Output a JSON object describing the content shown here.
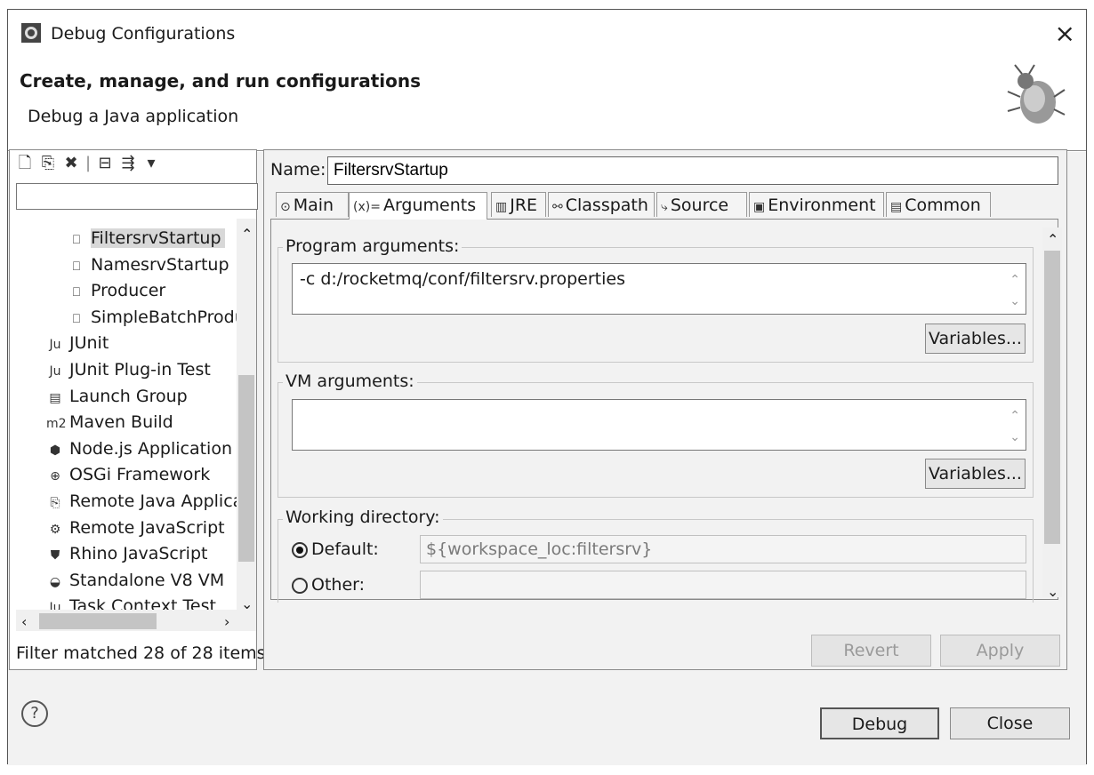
{
  "window": {
    "title": "Debug Configurations",
    "close_symbol": "×"
  },
  "header": {
    "title": "Create, manage, and run configurations",
    "subtitle": "Debug a Java application"
  },
  "left": {
    "toolbar_icons": [
      "new-launch-config-icon",
      "duplicate-icon",
      "delete-icon",
      "collapse-all-icon",
      "filter-icon",
      "view-menu-icon"
    ],
    "filter_value": "",
    "tree": [
      {
        "label": "FiltersrvStartup",
        "icon": "java-app-icon",
        "glyph": "⎕",
        "selected": true,
        "indent": 1
      },
      {
        "label": "NamesrvStartup",
        "icon": "java-app-icon",
        "glyph": "⎕",
        "selected": false,
        "indent": 1
      },
      {
        "label": "Producer",
        "icon": "java-app-icon",
        "glyph": "⎕",
        "selected": false,
        "indent": 1
      },
      {
        "label": "SimpleBatchProdu",
        "icon": "java-app-icon",
        "glyph": "⎕",
        "selected": false,
        "indent": 1
      },
      {
        "label": "JUnit",
        "icon": "junit-icon",
        "glyph": "Ju",
        "selected": false,
        "indent": 0
      },
      {
        "label": "JUnit Plug-in Test",
        "icon": "junit-plugin-icon",
        "glyph": "Ju",
        "selected": false,
        "indent": 0
      },
      {
        "label": "Launch Group",
        "icon": "launch-group-icon",
        "glyph": "▤",
        "selected": false,
        "indent": 0
      },
      {
        "label": "Maven Build",
        "icon": "maven-icon",
        "glyph": "m2",
        "selected": false,
        "indent": 0
      },
      {
        "label": "Node.js Application",
        "icon": "nodejs-icon",
        "glyph": "⬢",
        "selected": false,
        "indent": 0
      },
      {
        "label": "OSGi Framework",
        "icon": "osgi-icon",
        "glyph": "⊕",
        "selected": false,
        "indent": 0
      },
      {
        "label": "Remote Java Applica",
        "icon": "remote-java-icon",
        "glyph": "⎘",
        "selected": false,
        "indent": 0
      },
      {
        "label": "Remote JavaScript",
        "icon": "remote-js-icon",
        "glyph": "⚙",
        "selected": false,
        "indent": 0
      },
      {
        "label": "Rhino JavaScript",
        "icon": "rhino-icon",
        "glyph": "⛊",
        "selected": false,
        "indent": 0
      },
      {
        "label": "Standalone V8 VM",
        "icon": "v8-icon",
        "glyph": "◒",
        "selected": false,
        "indent": 0
      },
      {
        "label": "Task Context Test",
        "icon": "task-context-icon",
        "glyph": "Ju",
        "selected": false,
        "indent": 0
      }
    ],
    "status": "Filter matched 28 of 28 items"
  },
  "right": {
    "name_label": "Name:",
    "name_value": "FiltersrvStartup",
    "tabs": [
      {
        "label": "Main",
        "icon": "main-tab-icon",
        "glyph": "⊙",
        "active": false
      },
      {
        "label": "Arguments",
        "icon": "arguments-tab-icon",
        "glyph": "(x)=",
        "active": true
      },
      {
        "label": "JRE",
        "icon": "jre-tab-icon",
        "glyph": "▥",
        "active": false
      },
      {
        "label": "Classpath",
        "icon": "classpath-tab-icon",
        "glyph": "⚯",
        "active": false
      },
      {
        "label": "Source",
        "icon": "source-tab-icon",
        "glyph": "⤷",
        "active": false
      },
      {
        "label": "Environment",
        "icon": "environment-tab-icon",
        "glyph": "▣",
        "active": false
      },
      {
        "label": "Common",
        "icon": "common-tab-icon",
        "glyph": "▤",
        "active": false
      }
    ],
    "program_args_label": "Program arguments:",
    "program_args_value": "-c d:/rocketmq/conf/filtersrv.properties",
    "variables_label": "Variables...",
    "vm_args_label": "VM arguments:",
    "vm_args_value": "",
    "working_dir_label": "Working directory:",
    "default_label": "Default:",
    "default_value": "${workspace_loc:filtersrv}",
    "other_label": "Other:",
    "other_value": "",
    "default_selected": true
  },
  "buttons": {
    "revert": "Revert",
    "apply": "Apply",
    "debug": "Debug",
    "close": "Close",
    "help": "?"
  }
}
